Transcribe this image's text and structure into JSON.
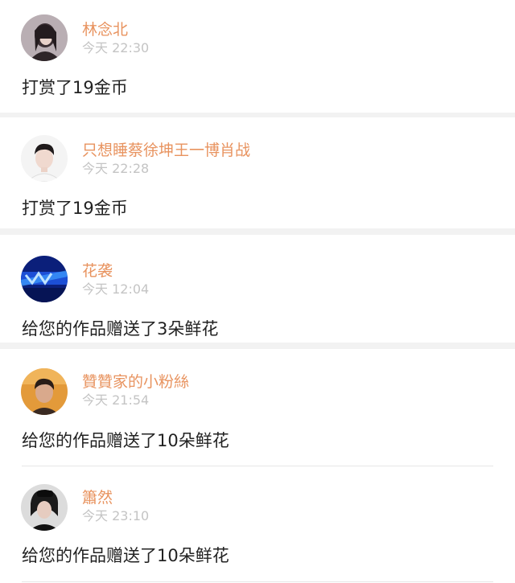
{
  "notifications": [
    {
      "username": "林念北",
      "time": "今天 22:30",
      "message": "打赏了19金币",
      "avatar_icon": "girl-portrait-avatar"
    },
    {
      "username": "只想睡蔡徐坤王一博肖战",
      "time": "今天 22:28",
      "message": "打赏了19金币",
      "avatar_icon": "boy-portrait-avatar"
    },
    {
      "username": "花袭",
      "time": "今天 12:04",
      "message": "给您的作品赠送了3朵鲜花",
      "avatar_icon": "blue-stage-avatar"
    },
    {
      "username": "贊贊家的小粉絲",
      "time": "今天 21:54",
      "message": "给您的作品赠送了10朵鲜花",
      "avatar_icon": "orange-portrait-avatar"
    },
    {
      "username": "簫然",
      "time": "今天 23:10",
      "message": "给您的作品赠送了10朵鲜花",
      "avatar_icon": "dark-portrait-avatar"
    }
  ],
  "colors": {
    "username": "#e8935f",
    "time": "#c4c4c4",
    "message": "#222222",
    "separator": "#f2f2f2"
  }
}
